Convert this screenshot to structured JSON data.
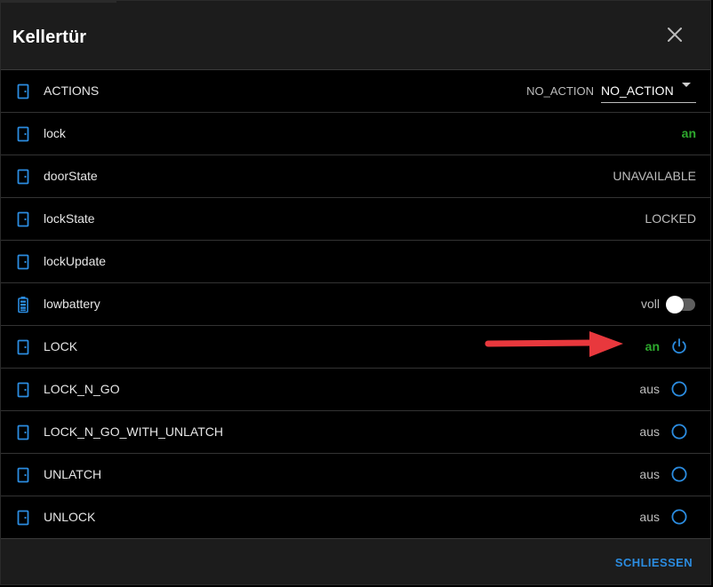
{
  "dialog": {
    "title": "Kellertür",
    "close_icon": "close-icon",
    "footer_button": "SCHLIESSEN"
  },
  "colors": {
    "accent": "#2b8ce0",
    "on_state": "#2eaa2e",
    "annotation_arrow": "#e8383d"
  },
  "rows": [
    {
      "icon": "door-icon",
      "label": "ACTIONS",
      "value": "NO_ACTION",
      "select_value": "NO_ACTION"
    },
    {
      "icon": "door-icon",
      "label": "lock",
      "value": "an"
    },
    {
      "icon": "door-icon",
      "label": "doorState",
      "value": "UNAVAILABLE"
    },
    {
      "icon": "door-icon",
      "label": "lockState",
      "value": "LOCKED"
    },
    {
      "icon": "door-icon",
      "label": "lockUpdate",
      "value": ""
    },
    {
      "icon": "battery-icon",
      "label": "lowbattery",
      "value": "voll",
      "toggle_on": false
    },
    {
      "icon": "door-icon",
      "label": "LOCK",
      "value": "an",
      "button_icon": "power-icon"
    },
    {
      "icon": "door-icon",
      "label": "LOCK_N_GO",
      "value": "aus",
      "button_icon": "circle-icon"
    },
    {
      "icon": "door-icon",
      "label": "LOCK_N_GO_WITH_UNLATCH",
      "value": "aus",
      "button_icon": "circle-icon"
    },
    {
      "icon": "door-icon",
      "label": "UNLATCH",
      "value": "aus",
      "button_icon": "circle-icon"
    },
    {
      "icon": "door-icon",
      "label": "UNLOCK",
      "value": "aus",
      "button_icon": "circle-icon"
    }
  ]
}
